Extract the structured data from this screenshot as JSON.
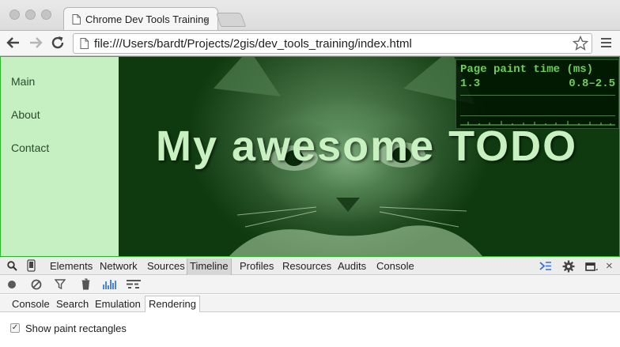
{
  "browser": {
    "tab_title": "Chrome Dev Tools Training",
    "tab_close": "×",
    "url": "file:///Users/bardt/Projects/2gis/dev_tools_training/index.html"
  },
  "page": {
    "nav": [
      "Main",
      "About",
      "Contact"
    ],
    "title": "My awesome TODO",
    "hud": {
      "title": "Page paint time (ms)",
      "current": "1.3",
      "range": "0.8–2.5"
    }
  },
  "devtools": {
    "tabs": [
      "Elements",
      "Network",
      "Sources",
      "Timeline",
      "Profiles",
      "Resources",
      "Audits",
      "Console"
    ],
    "active_tab": "Timeline",
    "drawer_tabs": [
      "Console",
      "Search",
      "Emulation",
      "Rendering"
    ],
    "active_drawer_tab": "Rendering",
    "checkbox_label": "Show paint rectangles",
    "checkbox_checked": true
  },
  "colors": {
    "accent_green": "#2db72d",
    "hud_text": "#6fce5b",
    "sidebar_bg": "#c6f0c2",
    "timeline_bars": "#4a86d9"
  }
}
